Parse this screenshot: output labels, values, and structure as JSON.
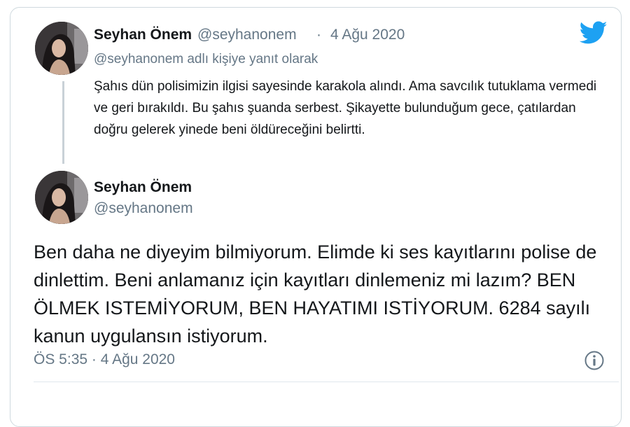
{
  "parent_tweet": {
    "author_name": "Seyhan Önem",
    "author_handle": "@seyhanonem",
    "separator": "·",
    "date": "4 Ağu 2020",
    "reply_context": "@seyhanonem adlı kişiye yanıt olarak",
    "text": "Şahıs dün polisimizin ilgisi sayesinde karakola alındı. Ama savcılık tutuklama vermedi ve geri bırakıldı. Bu şahıs şuanda serbest. Şikayette bulunduğum gece, çatılardan doğru gelerek yinede beni öldüreceğini belirtti."
  },
  "main_tweet": {
    "author_name": "Seyhan Önem",
    "author_handle": "@seyhanonem",
    "text": "Ben daha ne diyeyim bilmiyorum. Elimde ki ses kayıtlarını polise de dinlettim. Beni anlamanız için kayıtları dinlemeniz mi lazım? BEN ÖLMEK ISTEMİYORUM, BEN HAYATIMI ISTİYORUM. 6284 sayılı kanun uygulansın istiyorum.",
    "timestamp": "ÖS 5:35 · 4 Ağu 2020"
  },
  "icons": {
    "logo": "twitter-bird-icon",
    "info": "info-icon"
  },
  "colors": {
    "brand": "#1da1f2",
    "muted": "#657786",
    "text": "#14171a",
    "border": "#cfd9de"
  }
}
